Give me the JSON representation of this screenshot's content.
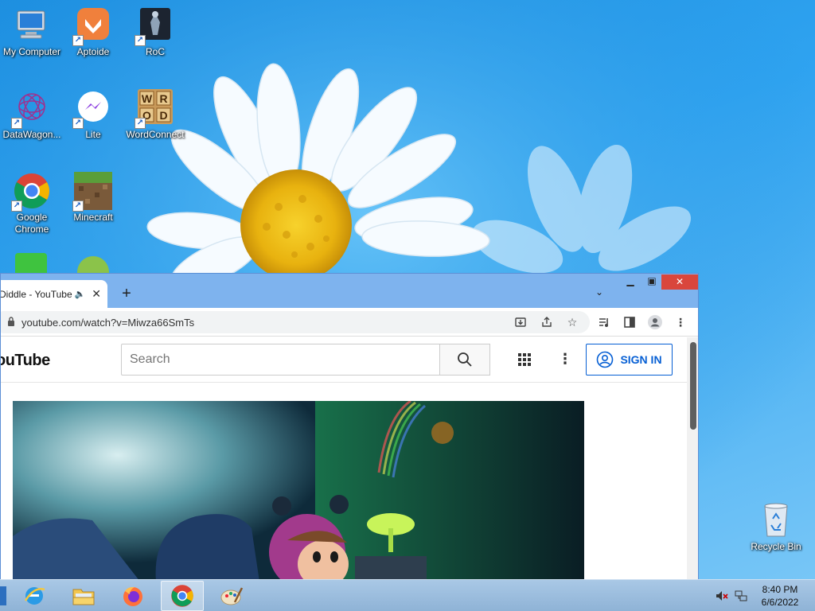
{
  "desktop": {
    "icons": [
      {
        "label": "My Computer",
        "icon": "computer-icon"
      },
      {
        "label": "Aptoide",
        "icon": "aptoide-icon"
      },
      {
        "label": "RoC",
        "icon": "roc-game-icon"
      },
      {
        "label": "DataWagon...",
        "icon": "datawagon-icon"
      },
      {
        "label": "Lite",
        "icon": "messenger-lite-icon"
      },
      {
        "label": "WordConnect",
        "icon": "wordconnect-icon"
      },
      {
        "label": "Google Chrome",
        "icon": "chrome-icon"
      },
      {
        "label": "Minecraft",
        "icon": "minecraft-icon"
      },
      {
        "label": "Recycle Bin",
        "icon": "recycle-bin-icon"
      }
    ],
    "wordconnect_tiles": [
      "W",
      "R",
      "O",
      "D"
    ]
  },
  "browser": {
    "tab_title": "Diddle - YouTube",
    "tab_audio_icon": "speaker-icon",
    "tab_close": "✕",
    "new_tab": "+",
    "tab_search": "⌄",
    "url": "youtube.com/watch?v=Miwza66SmTs",
    "window_controls": {
      "minimize": "▁",
      "maximize": "▣",
      "close": "✕"
    }
  },
  "youtube": {
    "logo_text": "ouTube",
    "search_placeholder": "Search",
    "signin_label": "SIGN IN",
    "more_label": "⋮"
  },
  "taskbar": {
    "apps": [
      "internet-explorer-icon",
      "file-explorer-icon",
      "firefox-icon",
      "chrome-icon",
      "paint-icon"
    ],
    "active_app": "chrome-icon",
    "clock_time": "8:40 PM",
    "clock_date": "6/6/2022"
  },
  "colors": {
    "desktop_blue": "#2fa3f0",
    "chrome_frame": "#7eb3ee",
    "close_red": "#d9463c",
    "youtube_blue": "#065fd4"
  }
}
